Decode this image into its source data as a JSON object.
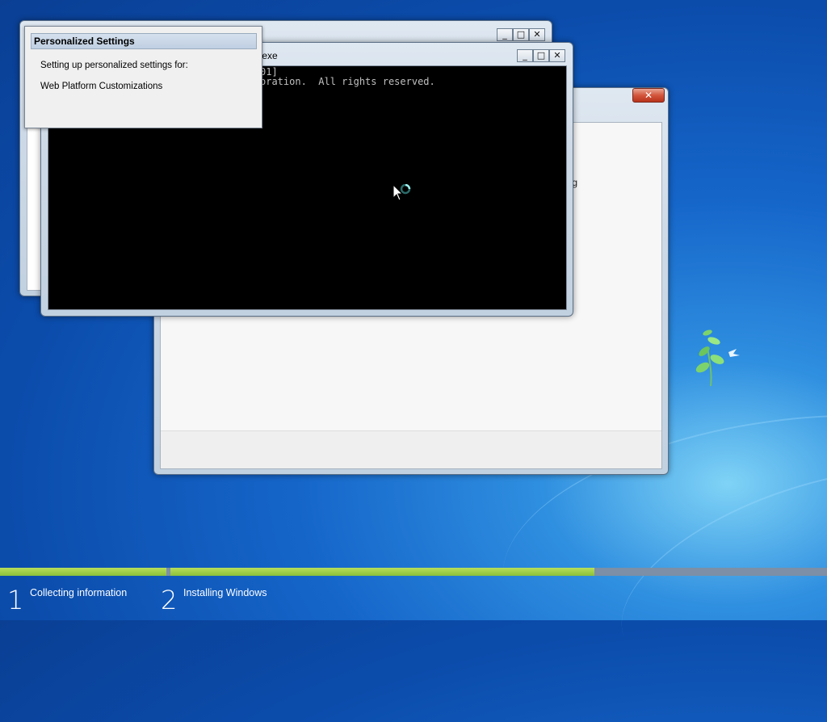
{
  "setup_window": {
    "close_symbol": "✕",
    "partial_text": "ing"
  },
  "background_window": {
    "minimize_symbol": "_",
    "maximize_symbol": "□",
    "close_symbol": "✕"
  },
  "cmd_window": {
    "title": ".exe",
    "minimize_symbol": "_",
    "maximize_symbol": "□",
    "close_symbol": "✕",
    "console_lines": [
      "01]",
      "oration.  All rights reserved."
    ]
  },
  "personalized_settings": {
    "header": "Personalized Settings",
    "line1": "Setting up personalized settings for:",
    "line2": "Web Platform Customizations"
  },
  "progress": {
    "stage1_fraction": 1.0,
    "stage2_fraction": 0.64,
    "stages": [
      {
        "number": "1",
        "label": "Collecting information"
      },
      {
        "number": "2",
        "label": "Installing Windows"
      }
    ]
  },
  "icons": {
    "busy_cursor": "busy-cursor-icon",
    "background_logo": "windows-tree-logo-icon"
  },
  "colors": {
    "desktop_blue": "#1565c9",
    "progress_green": "#8cc03a",
    "progress_track": "#7c8fa6",
    "console_bg": "#000000"
  }
}
